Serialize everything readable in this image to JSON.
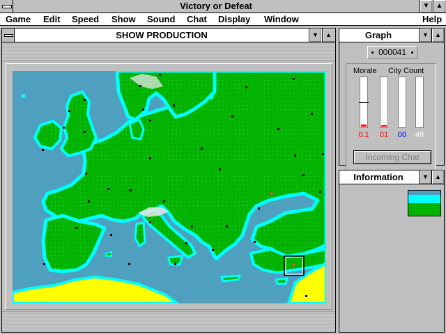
{
  "app": {
    "title": "Victory or Defeat"
  },
  "menu": [
    "Game",
    "Edit",
    "Speed",
    "Show",
    "Sound",
    "Chat",
    "Display",
    "Window",
    "Help"
  ],
  "map_window": {
    "title": "SHOW PRODUCTION"
  },
  "graph": {
    "title": "Graph",
    "counter": "000041",
    "morale_label": "Morale",
    "city_label": "City Count",
    "values": [
      "0.1",
      "01",
      "00",
      "49"
    ],
    "value_colors": [
      "#ff0000",
      "#ff0000",
      "#0000ff",
      "#ffffff"
    ],
    "fill_levels": [
      0.06,
      0.03,
      0,
      0.98
    ],
    "chat_button": "Incoming Chat"
  },
  "information": {
    "title": "Information"
  },
  "colors": {
    "sea": "#4f9fbf",
    "land": "#00b400",
    "coast": "#00ffff",
    "desert": "#ffff00",
    "frame": "#c0c0c0"
  }
}
